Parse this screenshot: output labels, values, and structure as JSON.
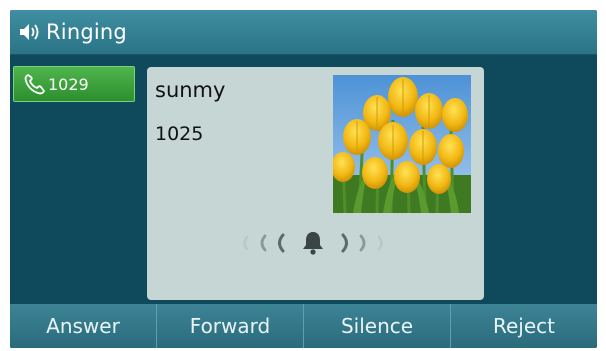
{
  "header": {
    "title": "Ringing",
    "icon": "speaker-icon"
  },
  "line": {
    "number": "1029",
    "icon": "phone-icon",
    "color": "#3aa53a"
  },
  "caller": {
    "name": "sunmy",
    "number": "1025",
    "photo": "tulips-photo"
  },
  "indicator": {
    "icon": "bell-icon"
  },
  "softkeys": [
    {
      "label": "Answer"
    },
    {
      "label": "Forward"
    },
    {
      "label": "Silence"
    },
    {
      "label": "Reject"
    }
  ]
}
